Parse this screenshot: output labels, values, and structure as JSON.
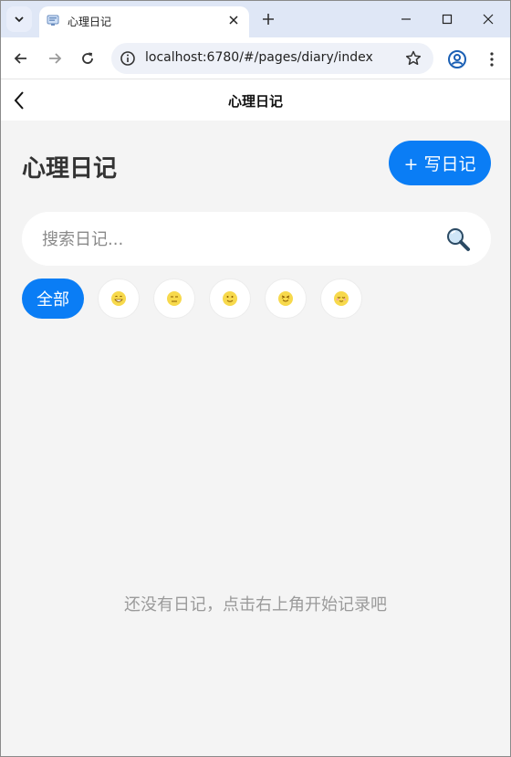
{
  "browser": {
    "tab_title": "心理日记",
    "url": "localhost:6780/#/pages/diary/index"
  },
  "header": {
    "title": "心理日记"
  },
  "page": {
    "title": "心理日记",
    "write_button": "+ 写日记",
    "search_placeholder": "搜索日记...",
    "filter_all": "全部",
    "moods": [
      "smiling-face",
      "neutral-face",
      "slight-smile-face",
      "grinning-squint-face",
      "relieved-face"
    ],
    "empty_message": "还没有日记，点击右上角开始记录吧"
  },
  "colors": {
    "accent": "#0a7df5",
    "background": "#f4f4f4",
    "emoji": "#f7d94c"
  }
}
